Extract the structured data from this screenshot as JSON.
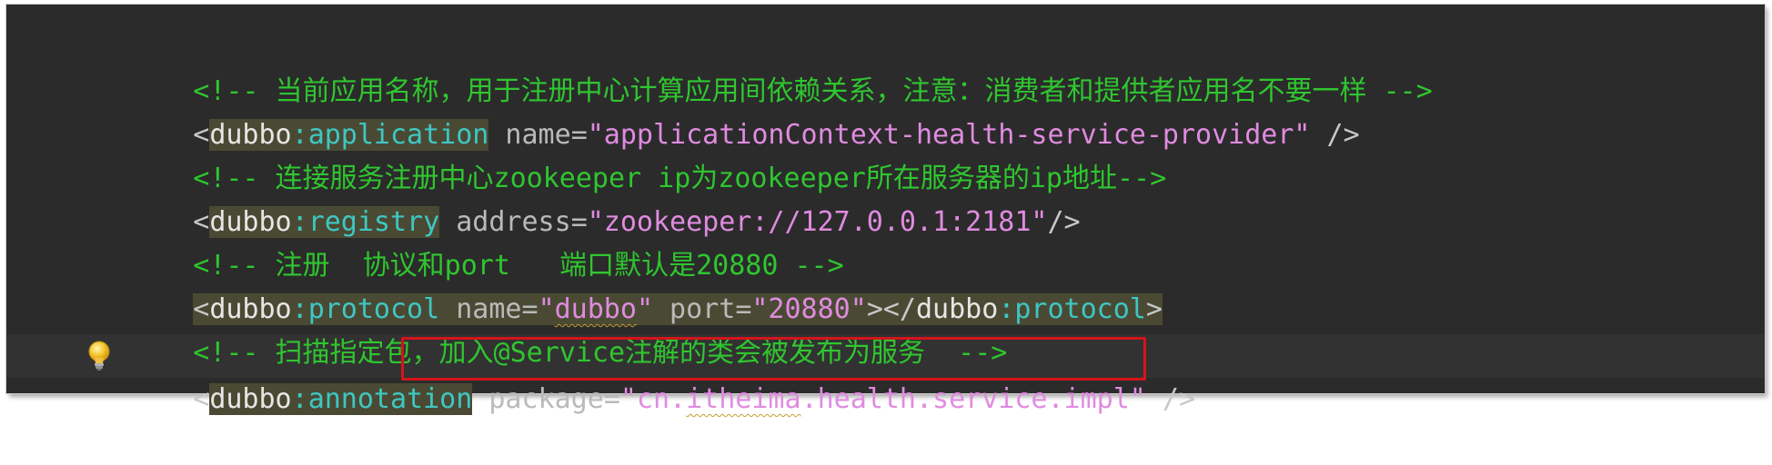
{
  "editor": {
    "lines": [
      {
        "kind": "comment",
        "text": "<!-- 当前应用名称，用于注册中心计算应用间依赖关系，注意：消费者和提供者应用名不要一样 -->"
      },
      {
        "kind": "element",
        "open": "<",
        "ns": "dubbo",
        "colon": ":",
        "tag": "application",
        "attr1_name": " name",
        "eq": "=",
        "attr1_value": "\"applicationContext-health-service-provider\"",
        "close": " />"
      },
      {
        "kind": "comment",
        "text": "<!-- 连接服务注册中心zookeeper ip为zookeeper所在服务器的ip地址-->"
      },
      {
        "kind": "element",
        "open": "<",
        "ns": "dubbo",
        "colon": ":",
        "tag": "registry",
        "attr1_name": " address",
        "eq": "=",
        "attr1_value": "\"zookeeper://127.0.0.1:2181\"",
        "close": "/>"
      },
      {
        "kind": "comment",
        "text": "<!-- 注册  协议和port   端口默认是20880 -->"
      },
      {
        "kind": "element",
        "open": "<",
        "ns": "dubbo",
        "colon": ":",
        "tag": "protocol",
        "attr1_name": " name",
        "eq": "=",
        "q": "\"",
        "attr1_value_word": "dubbo",
        "attr2_name": " port",
        "attr2_value": "\"20880\"",
        "mid": "></",
        "close_ns": "dubbo",
        "close_tag": "protocol",
        "end": ">"
      },
      {
        "kind": "comment",
        "text": "<!-- 扫描指定包，加入@Service注解的类会被发布为服务  -->"
      },
      {
        "kind": "element",
        "open": "<",
        "ns": "dubbo",
        "colon": ":",
        "tag": "annotation",
        "space": " ",
        "attr1_name": "package",
        "eq": "=",
        "q": "\"",
        "val_a": "cn.",
        "val_b": "itheima",
        "val_c": ".health.service.impl",
        "close": " />"
      }
    ]
  },
  "colors": {
    "background": "#2b2b2b",
    "comment": "#2fc62f",
    "tag": "#3ec7c3",
    "string": "#e08be0",
    "highlight": "#4a4a34",
    "annotation_box": "#d4141b"
  },
  "icons": {
    "gutter": "lightbulb-icon"
  }
}
